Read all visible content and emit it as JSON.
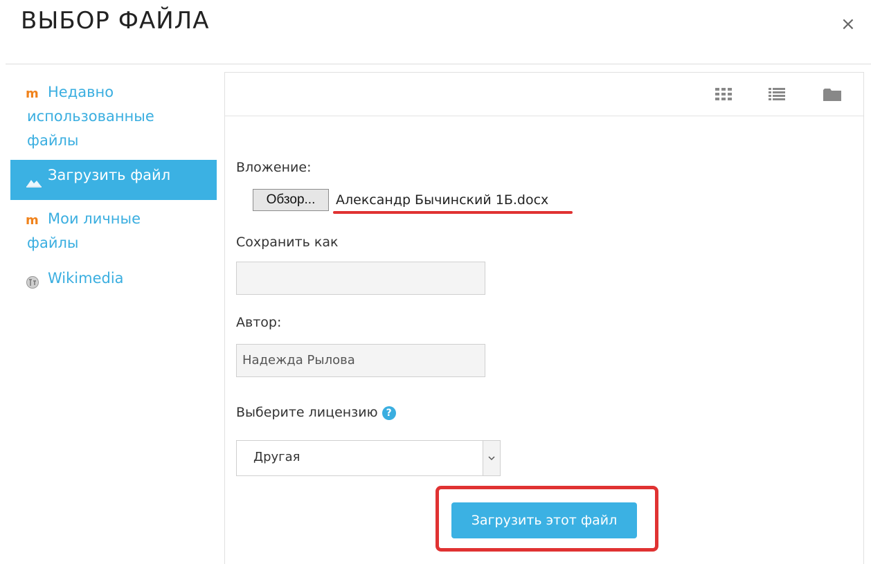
{
  "dialog": {
    "title": "ВЫБОР ФАЙЛА",
    "close_glyph": "×"
  },
  "sidebar": {
    "items": [
      {
        "label_line1": "Недавно",
        "label_line2": "использованные",
        "label_line3": "файлы",
        "icon": "moodle-icon"
      },
      {
        "label": "Загрузить файл",
        "icon": "upload-icon",
        "active": true
      },
      {
        "label_line1": "Мои личные",
        "label_line2": "файлы",
        "icon": "moodle-icon"
      },
      {
        "label": "Wikimedia",
        "icon": "wikimedia-icon"
      }
    ]
  },
  "toolbar": {
    "icons": [
      "grid-view-icon",
      "list-view-icon",
      "folder-view-icon"
    ]
  },
  "form": {
    "attachment_label": "Вложение:",
    "browse_label": "Обзор...",
    "selected_file": "Александр Бычинский 1Б.docx",
    "save_as_label": "Сохранить как",
    "save_as_value": "",
    "author_label": "Автор:",
    "author_value": "Надежда Рылова",
    "license_label": "Выберите лицензию",
    "license_value": "Другая",
    "upload_button": "Загрузить этот файл"
  },
  "colors": {
    "accent": "#3bb1e3",
    "highlight": "#e03232",
    "moodle_orange": "#f0821b"
  }
}
